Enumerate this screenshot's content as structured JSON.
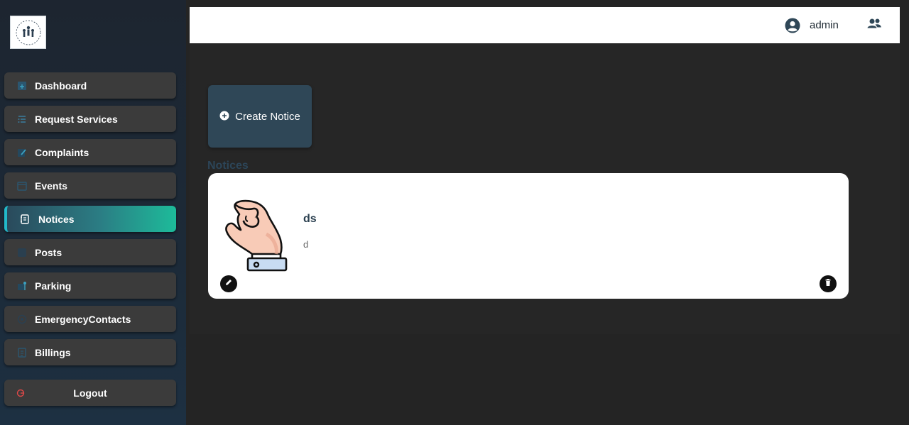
{
  "sidebar": {
    "logo_alt": "community logo",
    "items": [
      {
        "label": "Dashboard",
        "icon": "dashboard-icon"
      },
      {
        "label": "Request Services",
        "icon": "list-icon"
      },
      {
        "label": "Complaints",
        "icon": "edit-note-icon"
      },
      {
        "label": "Events",
        "icon": "calendar-icon"
      },
      {
        "label": "Notices",
        "icon": "notice-icon",
        "active": true
      },
      {
        "label": "Posts",
        "icon": "posts-icon"
      },
      {
        "label": "Parking",
        "icon": "parking-icon"
      },
      {
        "label": "EmergencyContacts",
        "icon": "contacts-icon"
      },
      {
        "label": "Billings",
        "icon": "billing-icon"
      }
    ],
    "logout_label": "Logout"
  },
  "header": {
    "user_name": "admin"
  },
  "main": {
    "create_label": "Create Notice",
    "section_title": "Notices",
    "notices": [
      {
        "title": "ds",
        "body": "d"
      }
    ]
  },
  "colors": {
    "accent_gradient_start": "#2a4a5c",
    "accent_gradient_end": "#1dbb9a",
    "nav_bg": "#3b3b3b",
    "create_btn_bg": "#2f4757",
    "logout_icon": "#e04848"
  }
}
